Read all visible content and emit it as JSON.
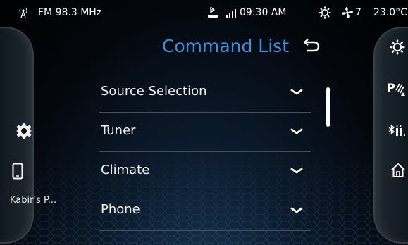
{
  "status_bar": {
    "radio": "FM 98.3 MHz",
    "time": "09:30 AM",
    "fan_level": "7",
    "temperature": "23.0°C"
  },
  "title": "Command List",
  "commands": [
    {
      "label": "Source Selection"
    },
    {
      "label": "Tuner"
    },
    {
      "label": "Climate"
    },
    {
      "label": "Phone"
    }
  ],
  "left_panel": {
    "phone_name": "Kabir's P..."
  },
  "right_panel": {
    "icons": [
      "climate-icon",
      "park-assist-icon",
      "bluetooth-icon",
      "home-icon"
    ]
  },
  "colors": {
    "accent": "#3d8fe0",
    "divider": "#4a4f55",
    "background": "#03070c"
  }
}
